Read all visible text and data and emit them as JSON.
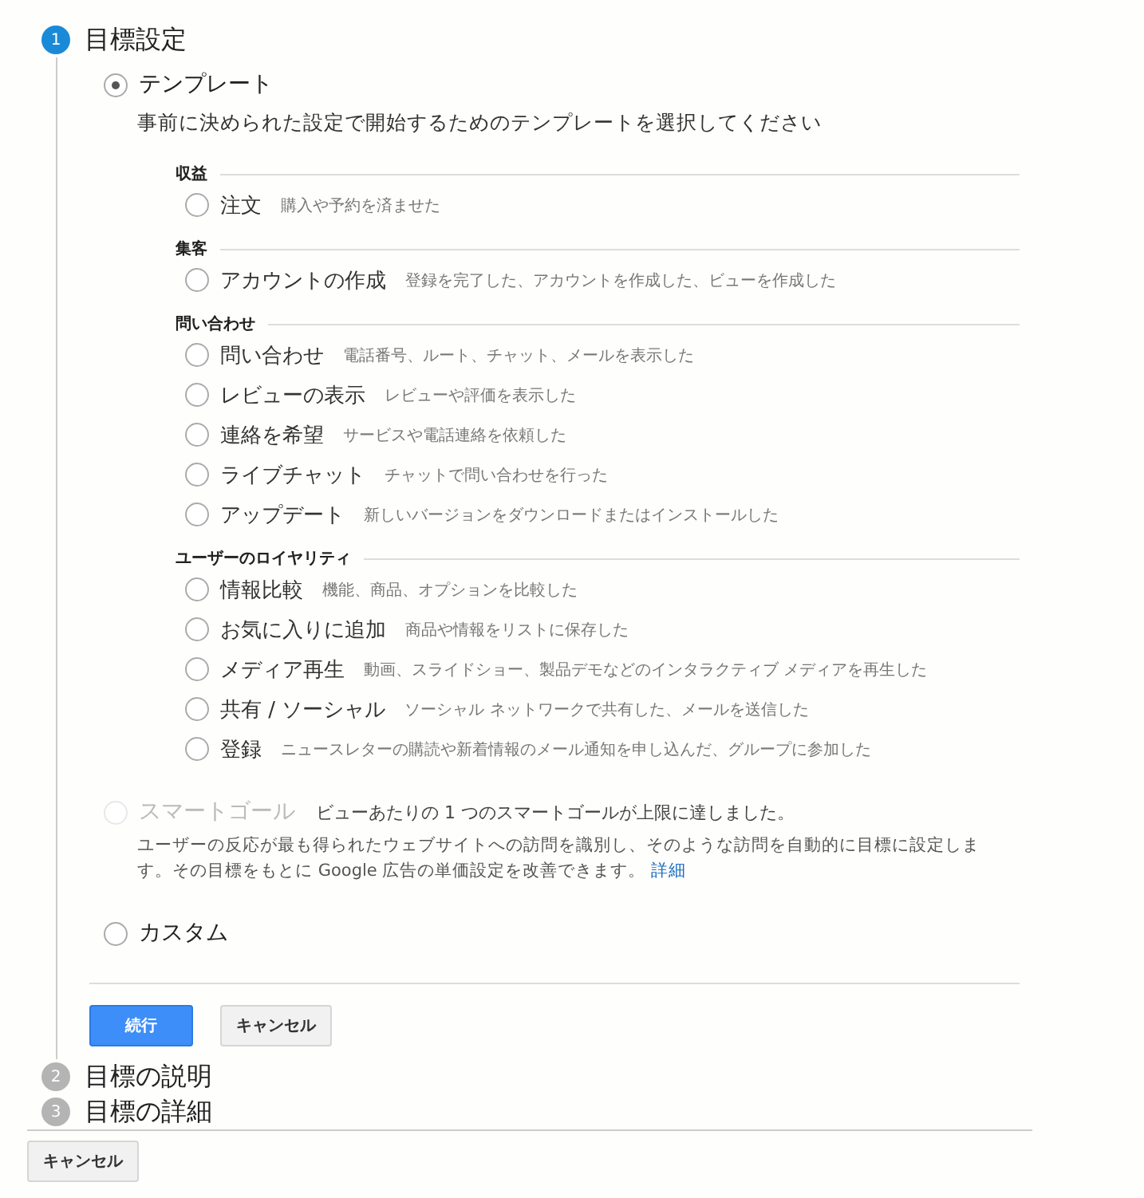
{
  "steps": [
    {
      "number": "1",
      "title": "目標設定",
      "active": true
    },
    {
      "number": "2",
      "title": "目標の説明",
      "active": false
    },
    {
      "number": "3",
      "title": "目標の詳細",
      "active": false
    }
  ],
  "goal_setup": {
    "template": {
      "label": "テンプレート",
      "selected": true,
      "description": "事前に決められた設定で開始するためのテンプレートを選択してください",
      "groups": [
        {
          "heading": "収益",
          "options": [
            {
              "label": "注文",
              "detail": "購入や予約を済ませた",
              "selected": false
            }
          ]
        },
        {
          "heading": "集客",
          "options": [
            {
              "label": "アカウントの作成",
              "detail": "登録を完了した、アカウントを作成した、ビューを作成した",
              "selected": false
            }
          ]
        },
        {
          "heading": "問い合わせ",
          "options": [
            {
              "label": "問い合わせ",
              "detail": "電話番号、ルート、チャット、メールを表示した",
              "selected": false
            },
            {
              "label": "レビューの表示",
              "detail": "レビューや評価を表示した",
              "selected": false
            },
            {
              "label": "連絡を希望",
              "detail": "サービスや電話連絡を依頼した",
              "selected": false
            },
            {
              "label": "ライブチャット",
              "detail": "チャットで問い合わせを行った",
              "selected": false
            },
            {
              "label": "アップデート",
              "detail": "新しいバージョンをダウンロードまたはインストールした",
              "selected": false
            }
          ]
        },
        {
          "heading": "ユーザーのロイヤリティ",
          "options": [
            {
              "label": "情報比較",
              "detail": "機能、商品、オプションを比較した",
              "selected": false
            },
            {
              "label": "お気に入りに追加",
              "detail": "商品や情報をリストに保存した",
              "selected": false
            },
            {
              "label": "メディア再生",
              "detail": "動画、スライドショー、製品デモなどのインタラクティブ メディアを再生した",
              "selected": false
            },
            {
              "label": "共有 / ソーシャル",
              "detail": "ソーシャル ネットワークで共有した、メールを送信した",
              "selected": false
            },
            {
              "label": "登録",
              "detail": "ニュースレターの購読や新着情報のメール通知を申し込んだ、グループに参加した",
              "selected": false
            }
          ]
        }
      ]
    },
    "smart_goal": {
      "label": "スマートゴール",
      "selected": false,
      "disabled": true,
      "note": "ビューあたりの 1 つのスマートゴールが上限に達しました。",
      "description": "ユーザーの反応が最も得られたウェブサイトへの訪問を識別し、そのような訪問を自動的に目標に設定します。その目標をもとに Google 広告の単価設定を改善できます。",
      "link": "詳細"
    },
    "custom": {
      "label": "カスタム",
      "selected": false
    },
    "buttons": [
      {
        "label": "続行",
        "kind": "primary"
      },
      {
        "label": "キャンセル",
        "kind": "secondary"
      }
    ]
  },
  "footer_button": "キャンセル"
}
